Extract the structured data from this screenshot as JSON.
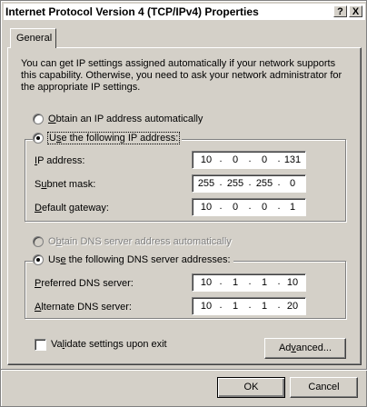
{
  "window": {
    "title": "Internet Protocol Version 4 (TCP/IPv4) Properties",
    "help_glyph": "?",
    "close_glyph": "X"
  },
  "tabs": [
    {
      "label": "General"
    }
  ],
  "intro_text": "You can get IP settings assigned automatically if your network supports this capability. Otherwise, you need to ask your network administrator for the appropriate IP settings.",
  "ip_section": {
    "auto_option": {
      "label_mn": "O",
      "label_rest": "btain an IP address automatically",
      "selected": false
    },
    "manual_option": {
      "label_mn": "s",
      "label_pre": "U",
      "label_rest": "e the following IP address:",
      "selected": true
    },
    "fields": [
      {
        "label_mn": "I",
        "label_rest": "P address:",
        "octets": [
          "10",
          "0",
          "0",
          "131"
        ]
      },
      {
        "label_pre": "S",
        "label_mn": "u",
        "label_rest": "bnet mask:",
        "octets": [
          "255",
          "255",
          "255",
          "0"
        ]
      },
      {
        "label_mn": "D",
        "label_rest": "efault gateway:",
        "octets": [
          "10",
          "0",
          "0",
          "1"
        ]
      }
    ]
  },
  "dns_section": {
    "auto_option": {
      "label_pre": "O",
      "label_mn": "b",
      "label_rest": "tain DNS server address automatically",
      "selected": false,
      "disabled": true
    },
    "manual_option": {
      "label_pre": "Us",
      "label_mn": "e",
      "label_rest": " the following DNS server addresses:",
      "selected": true
    },
    "fields": [
      {
        "label_mn": "P",
        "label_rest": "referred DNS server:",
        "octets": [
          "10",
          "1",
          "1",
          "10"
        ]
      },
      {
        "label_mn": "A",
        "label_rest": "lternate DNS server:",
        "octets": [
          "10",
          "1",
          "1",
          "20"
        ]
      }
    ]
  },
  "validate": {
    "label_pre": "Va",
    "label_mn": "l",
    "label_rest": "idate settings upon exit",
    "checked": false
  },
  "buttons": {
    "advanced_pre": "Ad",
    "advanced_mn": "v",
    "advanced_rest": "anced...",
    "ok": "OK",
    "cancel": "Cancel"
  }
}
